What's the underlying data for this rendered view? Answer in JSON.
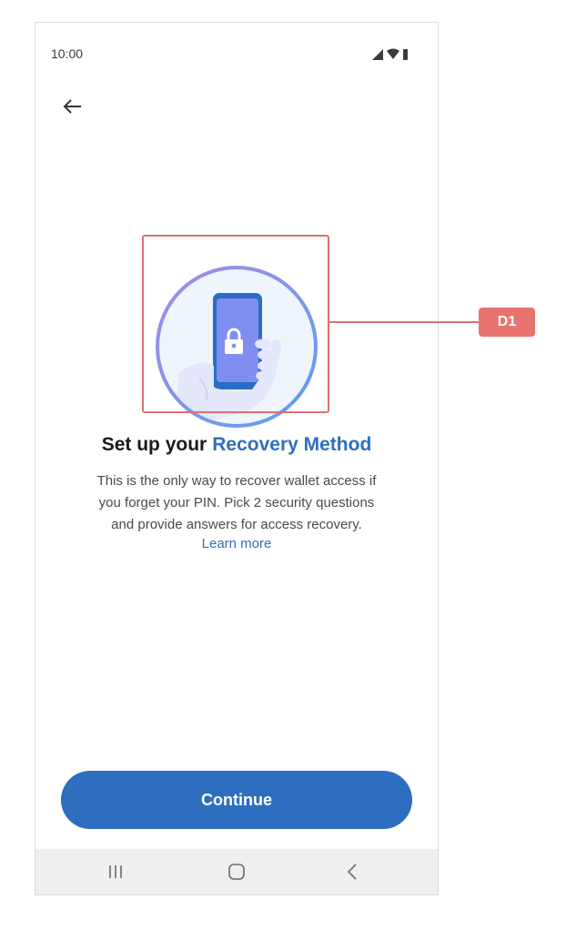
{
  "status_bar": {
    "time": "10:00",
    "icons": [
      "signal-icon",
      "wifi-icon",
      "battery-icon"
    ]
  },
  "header": {
    "back_icon": "arrow-left-icon"
  },
  "illustration": {
    "icon": "phone-lock-hand-icon"
  },
  "content": {
    "title_prefix": "Set up your",
    "title_highlight": "Recovery Method",
    "body_lines": [
      "This is the only way to recover wallet access if",
      "you forget your PIN. Pick 2 security questions",
      "and provide answers for access recovery."
    ],
    "learn_more": "Learn more"
  },
  "actions": {
    "continue_label": "Continue"
  },
  "nav_bar": {
    "items": [
      "recents-icon",
      "home-icon",
      "back-icon"
    ]
  },
  "annotation": {
    "label": "D1"
  },
  "colors": {
    "accent": "#2f6fbd",
    "button": "#2d6ebf",
    "annotation": "#e0706f",
    "nav_bg": "#efeff1"
  }
}
